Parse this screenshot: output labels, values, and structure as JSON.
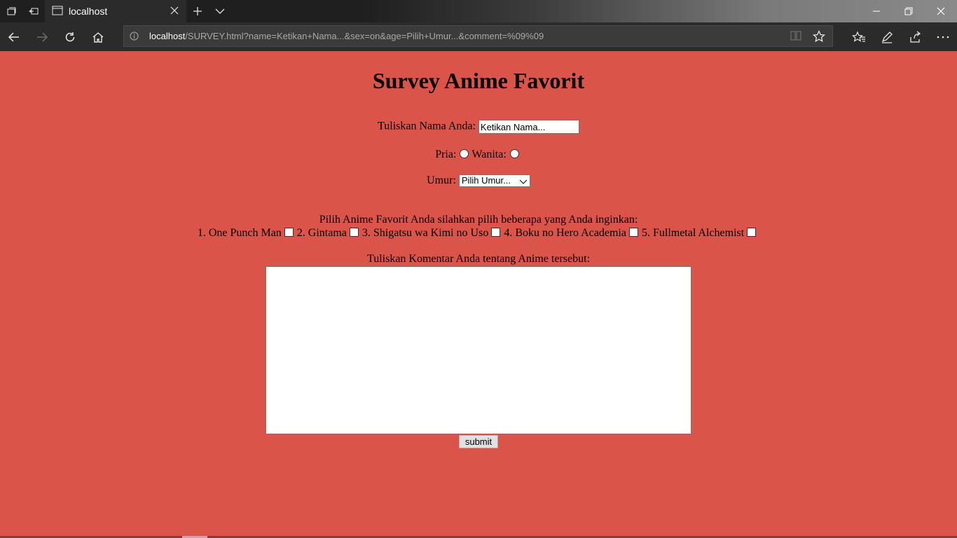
{
  "browser": {
    "tab_title": "localhost",
    "url_host": "localhost",
    "url_rest": "/SURVEY.html?name=Ketikan+Nama...&sex=on&age=Pilih+Umur...&comment=%09%09"
  },
  "page": {
    "title": "Survey Anime Favorit",
    "name_label": "Tuliskan Nama Anda:",
    "name_value": "Ketikan Nama...",
    "male_label": "Pria:",
    "female_label": "Wanita:",
    "age_label": "Umur:",
    "age_selected": "Pilih Umur...",
    "anime_prompt": "Pilih Anime Favorit Anda silahkan pilih beberapa yang Anda inginkan:",
    "anime_options": [
      "1. One Punch Man",
      "2. Gintama",
      "3. Shigatsu wa Kimi no Uso",
      "4. Boku no Hero Academia",
      "5. Fullmetal Alchemist"
    ],
    "comment_label": "Tuliskan Komentar Anda tentang Anime tersebut:",
    "submit_label": "submit"
  },
  "colors": {
    "page_background": "#db544a",
    "chrome_background": "#2b2b2b"
  }
}
